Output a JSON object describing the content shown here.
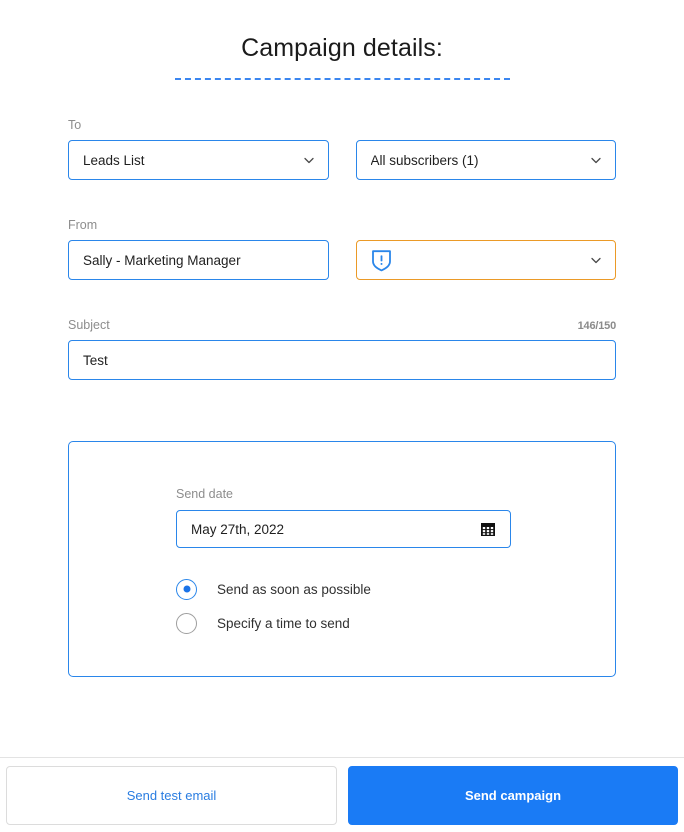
{
  "header": {
    "title": "Campaign details:"
  },
  "form": {
    "to": {
      "label": "To",
      "list_value": "Leads List",
      "segment_value": "All subscribers (1)",
      "list_icon": "chevron-down-icon",
      "segment_icon": "chevron-down-icon"
    },
    "from": {
      "label": "From",
      "name_value": "Sally - Marketing Manager",
      "email_value": "",
      "email_status_icon": "shield-warning-icon",
      "email_chevron_icon": "chevron-down-icon"
    },
    "subject": {
      "label": "Subject",
      "value": "Test",
      "counter": "146/150"
    }
  },
  "schedule": {
    "send_date_label": "Send date",
    "send_date_value": "May 27th, 2022",
    "calendar_icon": "calendar-icon",
    "options": [
      {
        "label": "Send as soon as possible",
        "selected": true
      },
      {
        "label": "Specify a time to send",
        "selected": false
      }
    ]
  },
  "footer": {
    "test_label": "Send test email",
    "send_label": "Send campaign"
  },
  "colors": {
    "accent_blue": "#2a86ea",
    "primary_button": "#1a7bf5",
    "warning_orange": "#eb9a27",
    "label_gray": "#8d8d8d"
  }
}
